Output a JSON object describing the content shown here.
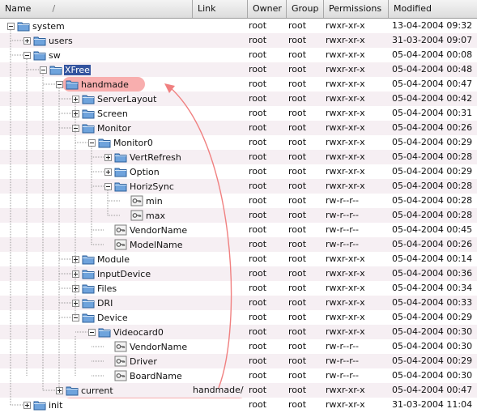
{
  "columns": {
    "name": "Name",
    "sort": "/",
    "link": "Link",
    "owner": "Owner",
    "group": "Group",
    "permissions": "Permissions",
    "modified": "Modified"
  },
  "rows": [
    {
      "name": "system",
      "icon": "folder-icon",
      "expander": "minus",
      "owner": "root",
      "group": "root",
      "perm": "rwxr-xr-x",
      "mod": "13-04-2004 09:32",
      "link": ""
    },
    {
      "name": "users",
      "icon": "folder-icon",
      "expander": "plus",
      "owner": "root",
      "group": "root",
      "perm": "rwxr-xr-x",
      "mod": "31-03-2004 09:07",
      "link": ""
    },
    {
      "name": "sw",
      "icon": "folder-icon",
      "expander": "minus",
      "owner": "root",
      "group": "root",
      "perm": "rwxr-xr-x",
      "mod": "05-04-2004 00:08",
      "link": ""
    },
    {
      "name": "XFree",
      "icon": "folder-icon",
      "expander": "minus",
      "owner": "root",
      "group": "root",
      "perm": "rwxr-xr-x",
      "mod": "05-04-2004 00:48",
      "link": "",
      "selected": true
    },
    {
      "name": "handmade",
      "icon": "folder-icon",
      "expander": "minus",
      "owner": "root",
      "group": "root",
      "perm": "rwxr-xr-x",
      "mod": "05-04-2004 00:47",
      "link": ""
    },
    {
      "name": "ServerLayout",
      "icon": "folder-icon",
      "expander": "plus",
      "owner": "root",
      "group": "root",
      "perm": "rwxr-xr-x",
      "mod": "05-04-2004 00:42",
      "link": ""
    },
    {
      "name": "Screen",
      "icon": "folder-icon",
      "expander": "plus",
      "owner": "root",
      "group": "root",
      "perm": "rwxr-xr-x",
      "mod": "05-04-2004 00:31",
      "link": ""
    },
    {
      "name": "Monitor",
      "icon": "folder-icon",
      "expander": "minus",
      "owner": "root",
      "group": "root",
      "perm": "rwxr-xr-x",
      "mod": "05-04-2004 00:26",
      "link": ""
    },
    {
      "name": "Monitor0",
      "icon": "folder-icon",
      "expander": "minus",
      "owner": "root",
      "group": "root",
      "perm": "rwxr-xr-x",
      "mod": "05-04-2004 00:29",
      "link": ""
    },
    {
      "name": "VertRefresh",
      "icon": "folder-icon",
      "expander": "plus",
      "owner": "root",
      "group": "root",
      "perm": "rwxr-xr-x",
      "mod": "05-04-2004 00:28",
      "link": ""
    },
    {
      "name": "Option",
      "icon": "folder-icon",
      "expander": "plus",
      "owner": "root",
      "group": "root",
      "perm": "rwxr-xr-x",
      "mod": "05-04-2004 00:29",
      "link": ""
    },
    {
      "name": "HorizSync",
      "icon": "folder-icon",
      "expander": "minus",
      "owner": "root",
      "group": "root",
      "perm": "rwxr-xr-x",
      "mod": "05-04-2004 00:28",
      "link": ""
    },
    {
      "name": "min",
      "icon": "key-file-icon",
      "expander": "",
      "owner": "root",
      "group": "root",
      "perm": "rw-r--r--",
      "mod": "05-04-2004 00:28",
      "link": ""
    },
    {
      "name": "max",
      "icon": "key-file-icon",
      "expander": "",
      "owner": "root",
      "group": "root",
      "perm": "rw-r--r--",
      "mod": "05-04-2004 00:28",
      "link": ""
    },
    {
      "name": "VendorName",
      "icon": "key-file-icon",
      "expander": "",
      "owner": "root",
      "group": "root",
      "perm": "rw-r--r--",
      "mod": "05-04-2004 00:45",
      "link": ""
    },
    {
      "name": "ModelName",
      "icon": "key-file-icon",
      "expander": "",
      "owner": "root",
      "group": "root",
      "perm": "rw-r--r--",
      "mod": "05-04-2004 00:26",
      "link": ""
    },
    {
      "name": "Module",
      "icon": "folder-icon",
      "expander": "plus",
      "owner": "root",
      "group": "root",
      "perm": "rwxr-xr-x",
      "mod": "05-04-2004 00:14",
      "link": ""
    },
    {
      "name": "InputDevice",
      "icon": "folder-icon",
      "expander": "plus",
      "owner": "root",
      "group": "root",
      "perm": "rwxr-xr-x",
      "mod": "05-04-2004 00:36",
      "link": ""
    },
    {
      "name": "Files",
      "icon": "folder-icon",
      "expander": "plus",
      "owner": "root",
      "group": "root",
      "perm": "rwxr-xr-x",
      "mod": "05-04-2004 00:34",
      "link": ""
    },
    {
      "name": "DRI",
      "icon": "folder-icon",
      "expander": "plus",
      "owner": "root",
      "group": "root",
      "perm": "rwxr-xr-x",
      "mod": "05-04-2004 00:33",
      "link": ""
    },
    {
      "name": "Device",
      "icon": "folder-icon",
      "expander": "minus",
      "owner": "root",
      "group": "root",
      "perm": "rwxr-xr-x",
      "mod": "05-04-2004 00:29",
      "link": ""
    },
    {
      "name": "Videocard0",
      "icon": "folder-icon",
      "expander": "minus",
      "owner": "root",
      "group": "root",
      "perm": "rwxr-xr-x",
      "mod": "05-04-2004 00:30",
      "link": ""
    },
    {
      "name": "VendorName",
      "icon": "key-file-icon",
      "expander": "",
      "owner": "root",
      "group": "root",
      "perm": "rw-r--r--",
      "mod": "05-04-2004 00:30",
      "link": ""
    },
    {
      "name": "Driver",
      "icon": "key-file-icon",
      "expander": "",
      "owner": "root",
      "group": "root",
      "perm": "rw-r--r--",
      "mod": "05-04-2004 00:29",
      "link": ""
    },
    {
      "name": "BoardName",
      "icon": "key-file-icon",
      "expander": "",
      "owner": "root",
      "group": "root",
      "perm": "rw-r--r--",
      "mod": "05-04-2004 00:30",
      "link": ""
    },
    {
      "name": "current",
      "icon": "folder-icon",
      "expander": "plus",
      "owner": "root",
      "group": "root",
      "perm": "rwxr-xr-x",
      "mod": "05-04-2004 00:47",
      "link": "handmade/"
    },
    {
      "name": "init",
      "icon": "folder-icon",
      "expander": "plus",
      "owner": "root",
      "group": "root",
      "perm": "rwxr-xr-x",
      "mod": "31-03-2004 11:04",
      "link": ""
    }
  ],
  "colors": {
    "selection": "#33539e",
    "highlight": "#f7a0a0",
    "alt_row": "#f6eff3",
    "arrow": "#f08080",
    "folder": "#6fa3dc"
  }
}
